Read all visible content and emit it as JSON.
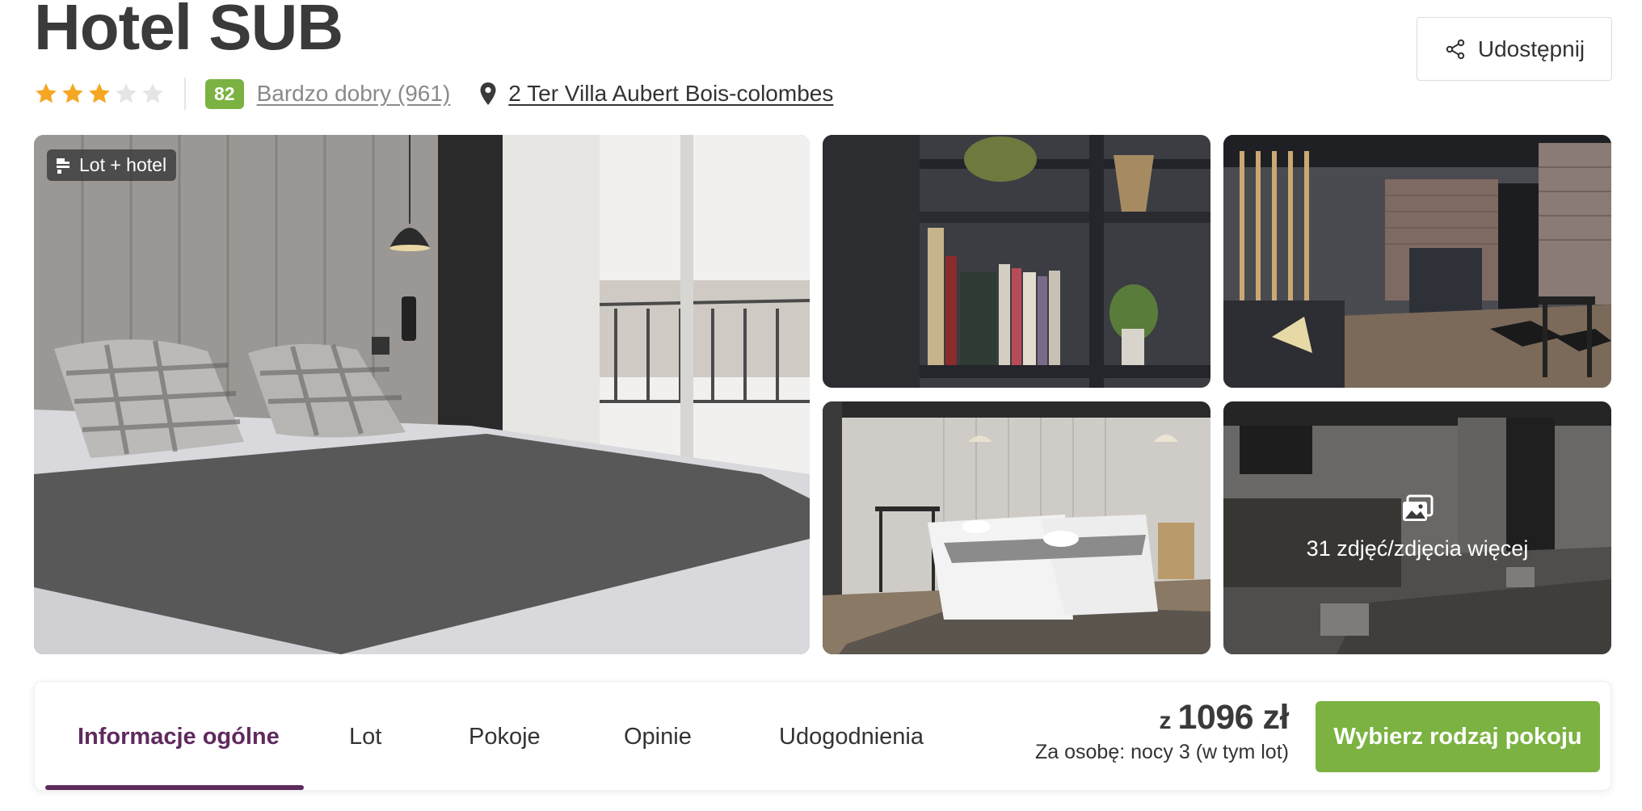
{
  "hotel": {
    "name": "Hotel SUB",
    "star_rating": 3,
    "max_stars": 5,
    "score": "82",
    "rating_text": "Bardzo dobry (961)",
    "address": "2 Ter Villa Aubert Bois-colombes"
  },
  "share": {
    "label": "Udostępnij",
    "icon": "share-icon"
  },
  "gallery": {
    "badge_label": "Lot + hotel",
    "badge_icon": "flight-hotel-icon",
    "more_photos_label": "31 zdjęć/zdjęcia więcej",
    "more_photos_icon": "photos-icon"
  },
  "nav": {
    "tabs": [
      {
        "label": "Informacje ogólne",
        "active": true
      },
      {
        "label": "Lot",
        "active": false
      },
      {
        "label": "Pokoje",
        "active": false
      },
      {
        "label": "Opinie",
        "active": false
      },
      {
        "label": "Udogodnienia",
        "active": false
      }
    ]
  },
  "pricing": {
    "prefix": "z",
    "price": "1096 zł",
    "note": "Za osobę: nocy 3 (w tym lot)",
    "cta_label": "Wybierz rodzaj pokoju"
  },
  "colors": {
    "accent_purple": "#5f2a5e",
    "brand_green": "#7bb241",
    "star_filled": "#f5a623",
    "star_empty": "#e5e5e5"
  }
}
